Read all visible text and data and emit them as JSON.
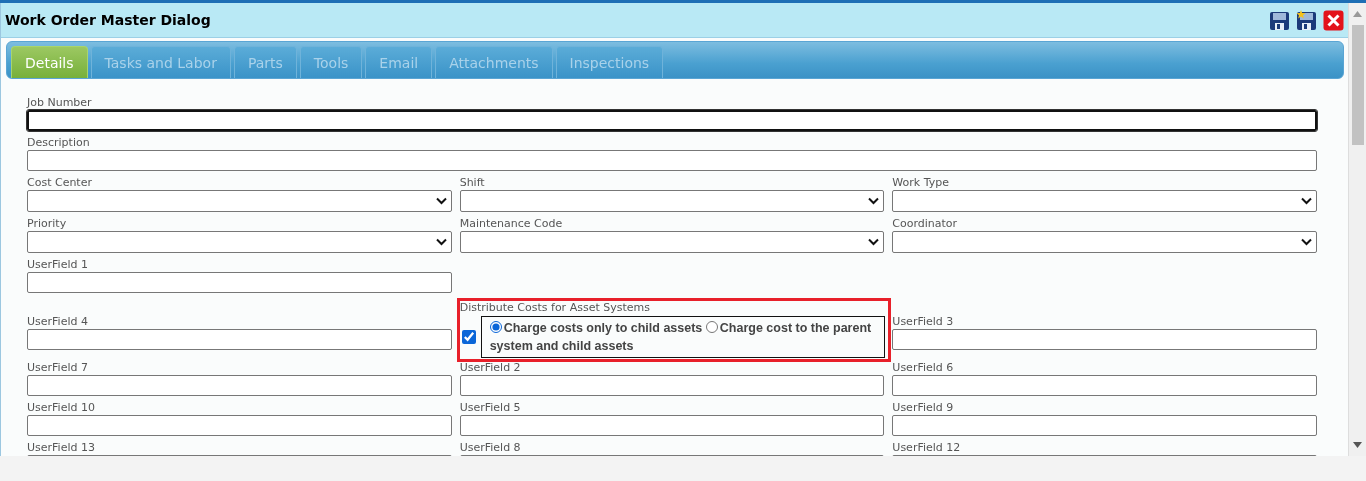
{
  "window": {
    "title": "Work Order Master Dialog"
  },
  "tabs": [
    {
      "label": "Details",
      "selected": true
    },
    {
      "label": "Tasks and Labor",
      "selected": false
    },
    {
      "label": "Parts",
      "selected": false
    },
    {
      "label": "Tools",
      "selected": false
    },
    {
      "label": "Email",
      "selected": false
    },
    {
      "label": "Attachments",
      "selected": false
    },
    {
      "label": "Inspections",
      "selected": false
    }
  ],
  "rows": [
    {
      "kind": "wide",
      "fields": [
        {
          "kind": "text",
          "label": "Job Number",
          "focused": true
        }
      ]
    },
    {
      "kind": "wide",
      "fields": [
        {
          "kind": "text",
          "label": "Description",
          "focused": false
        }
      ]
    },
    {
      "fields": [
        {
          "kind": "select",
          "label": "Cost Center",
          "focused": false
        },
        {
          "kind": "select",
          "label": "Shift",
          "focused": false
        },
        {
          "kind": "select",
          "label": "Work Type",
          "focused": false
        }
      ]
    },
    {
      "fields": [
        {
          "kind": "select",
          "label": "Priority",
          "focused": false
        },
        {
          "kind": "select",
          "label": "Maintenance Code",
          "focused": false
        },
        {
          "kind": "select",
          "label": "Coordinator",
          "focused": false
        }
      ]
    },
    {
      "fields": [
        {
          "kind": "text",
          "label": "UserField 1",
          "focused": false
        }
      ]
    },
    {
      "fields": [
        {
          "kind": "text",
          "label": "UserField 4",
          "focused": false
        },
        {
          "kind": "distribute",
          "label": "Distribute Costs for Asset Systems",
          "checked": true,
          "highlighted": true,
          "options": [
            {
              "label": "Charge costs only to child assets",
              "selected": true
            },
            {
              "label": "Charge cost to the parent system and child assets",
              "selected": false
            }
          ]
        },
        {
          "kind": "text",
          "label": "UserField 3",
          "focused": false
        }
      ]
    },
    {
      "fields": [
        {
          "kind": "text",
          "label": "UserField 7",
          "focused": false
        },
        {
          "kind": "text",
          "label": "UserField 2",
          "focused": false
        },
        {
          "kind": "text",
          "label": "UserField 6",
          "focused": false
        }
      ]
    },
    {
      "fields": [
        {
          "kind": "text",
          "label": "UserField 10",
          "focused": false
        },
        {
          "kind": "text",
          "label": "UserField 5",
          "focused": false
        },
        {
          "kind": "text",
          "label": "UserField 9",
          "focused": false
        }
      ]
    },
    {
      "fields": [
        {
          "kind": "text",
          "label": "UserField 13"
        },
        {
          "kind": "text",
          "label": "UserField 8"
        },
        {
          "kind": "text",
          "label": "UserField 12"
        }
      ]
    }
  ]
}
